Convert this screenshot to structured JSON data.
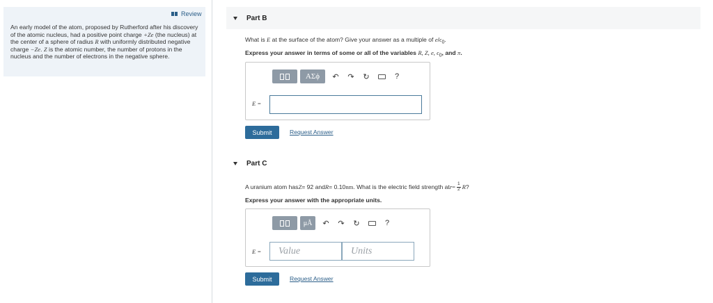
{
  "review": {
    "label": "Review"
  },
  "problem": {
    "t1": "An early model of the atom, proposed by Rutherford after his discovery of the atomic nucleus, had a positive point charge ",
    "t2": "+Ze",
    "t3": " (the nucleus) at the center of a sphere of radius ",
    "t4": "R",
    "t5": " with uniformly distributed negative charge ",
    "t6": "−Ze",
    "t7": ". ",
    "t8": "Z",
    "t9": " is the atomic number, the number of protons in the nucleus and the number of electrons in the negative sphere."
  },
  "partB": {
    "title": "Part B",
    "q1": "What is ",
    "q2": "E",
    "q3": " at the surface of the atom? Give your answer as a multiple of ",
    "q4": "e",
    "q5": "/",
    "q6": "ϵ",
    "q7": "0",
    "q8": ".",
    "instr1": "Express your answer in terms of some or all of the variables ",
    "instr2": "R, Z, e, ϵ",
    "instr3": "0",
    "instr4": ", and ",
    "instr5": "π",
    "instr6": ".",
    "sym_label": "ΑΣϕ",
    "help": "?",
    "eq_label": "E =",
    "input_value": "",
    "submit": "Submit",
    "request": "Request Answer"
  },
  "partC": {
    "title": "Part C",
    "q1": "A uranium atom has ",
    "q2": "Z",
    "q3": " = 92 and ",
    "q4": "R",
    "q5": " = 0.10 ",
    "q6": "nm",
    "q7": ". What is the electric field strength at ",
    "q8": "r",
    "q9": " = ",
    "frac_num": "1",
    "frac_den": "2",
    "q10": "R",
    "q11": "?",
    "instr": "Express your answer with the appropriate units.",
    "unit_label": "μÅ",
    "help": "?",
    "eq_label": "E =",
    "value_placeholder": "Value",
    "units_placeholder": "Units",
    "submit": "Submit",
    "request": "Request Answer"
  },
  "colors": {
    "accent": "#2d6c9b",
    "link": "#2b5e88",
    "toolbar": "#8e9aa6",
    "problem_bg": "#eef3f8"
  },
  "icons": [
    "review-icon",
    "caret-down-icon",
    "template-icon",
    "symbols-icon",
    "undo-icon",
    "redo-icon",
    "reset-icon",
    "keyboard-icon",
    "help-icon",
    "units-template-icon"
  ]
}
